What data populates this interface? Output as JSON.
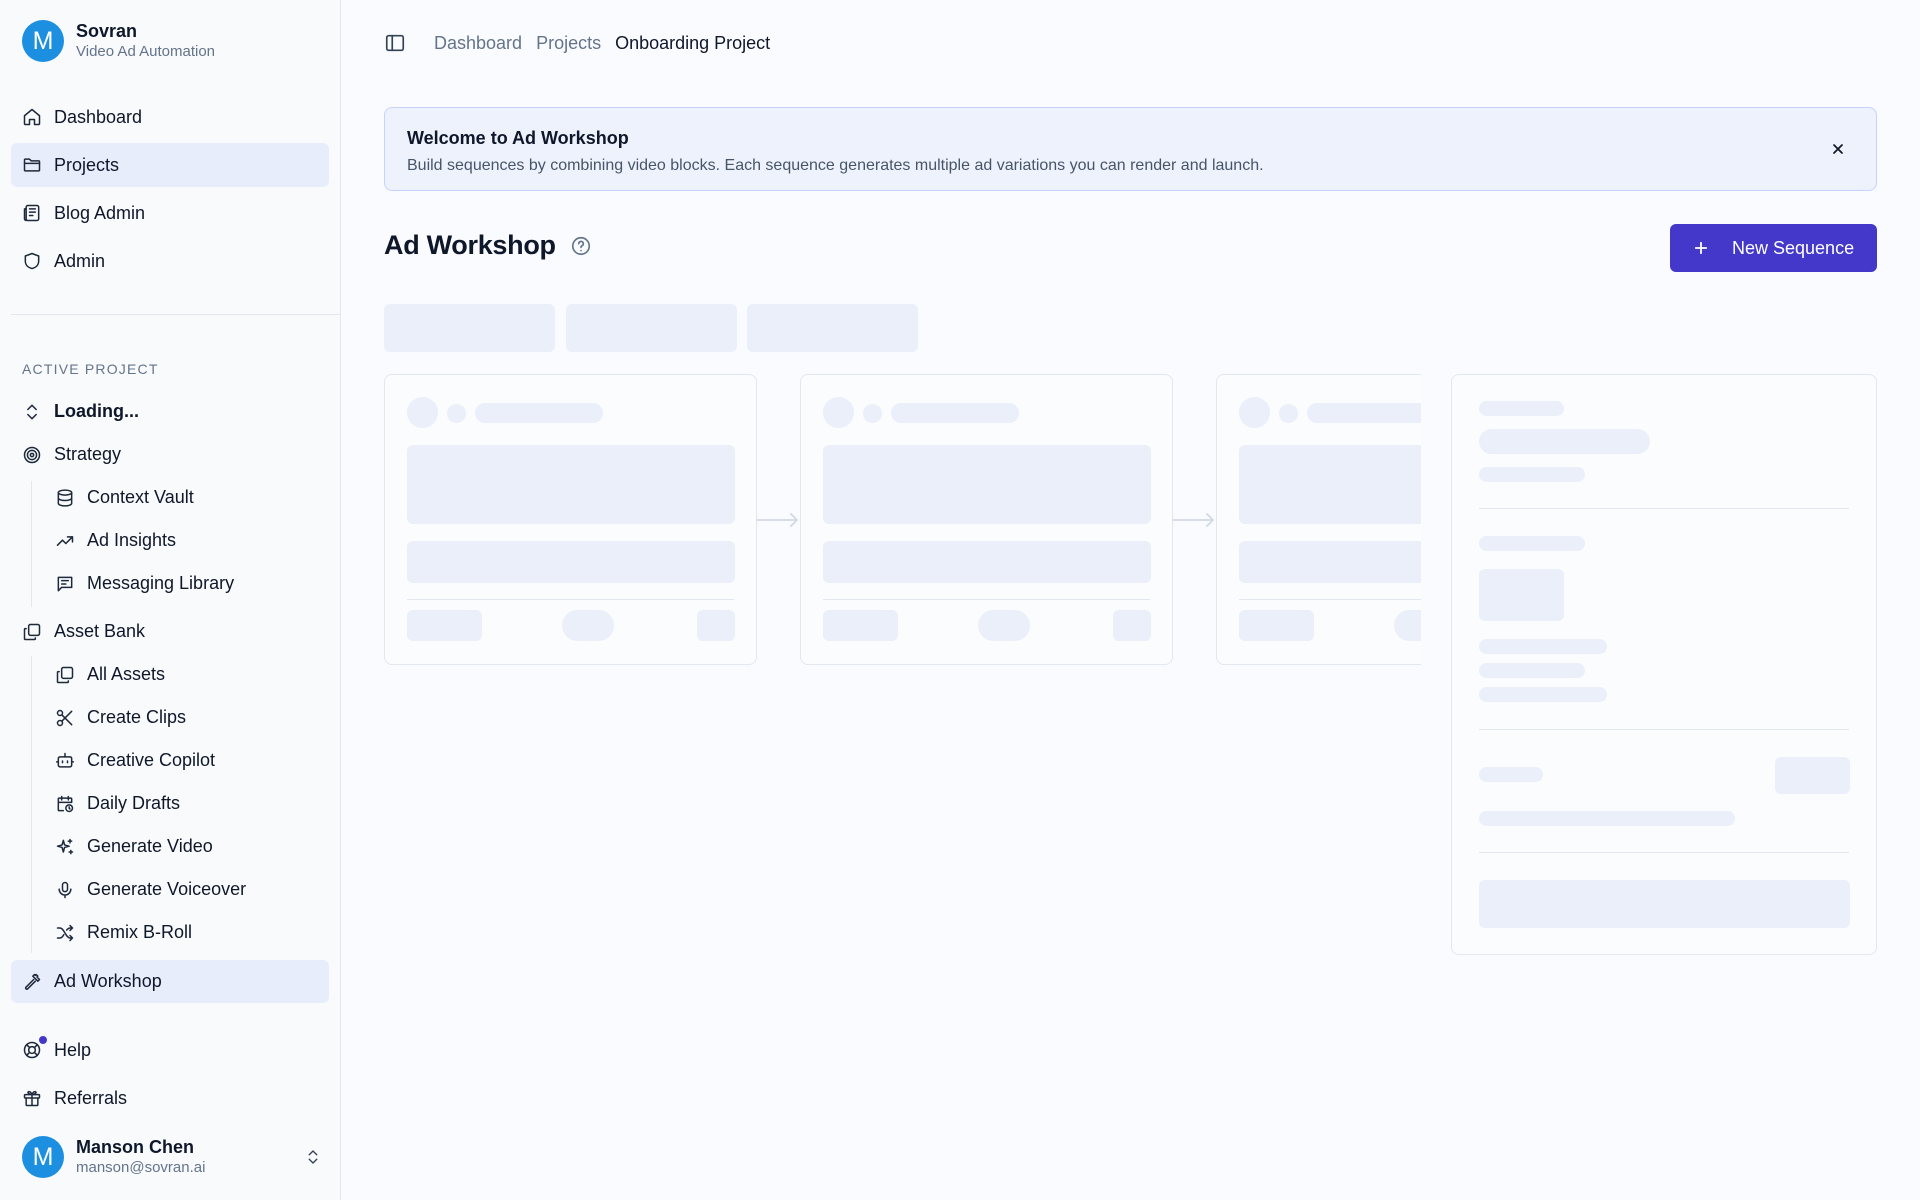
{
  "brand": {
    "initial": "M",
    "name": "Sovran",
    "subtitle": "Video Ad Automation"
  },
  "nav": {
    "main": [
      {
        "label": "Dashboard",
        "icon": "home-icon"
      },
      {
        "label": "Projects",
        "icon": "folder-icon",
        "active": true
      },
      {
        "label": "Blog Admin",
        "icon": "newspaper-icon"
      },
      {
        "label": "Admin",
        "icon": "shield-icon"
      }
    ],
    "section_label": "ACTIVE PROJECT",
    "project_selector": "Loading...",
    "strategy": {
      "label": "Strategy",
      "items": [
        "Context Vault",
        "Ad Insights",
        "Messaging Library"
      ]
    },
    "asset_bank": {
      "label": "Asset Bank",
      "items": [
        "All Assets",
        "Create Clips",
        "Creative Copilot",
        "Daily Drafts",
        "Generate Video",
        "Generate Voiceover",
        "Remix B-Roll"
      ]
    },
    "ad_workshop": "Ad Workshop",
    "bottom": [
      {
        "label": "Help",
        "icon": "lifebuoy-icon",
        "has_notification": true
      },
      {
        "label": "Referrals",
        "icon": "gift-icon"
      }
    ]
  },
  "user": {
    "initial": "M",
    "name": "Manson Chen",
    "email": "manson@sovran.ai"
  },
  "breadcrumb": [
    "Dashboard",
    "Projects",
    "Onboarding Project"
  ],
  "banner": {
    "title": "Welcome to Ad Workshop",
    "description": "Build sequences by combining video blocks. Each sequence generates multiple ad variations you can render and launch."
  },
  "page": {
    "title": "Ad Workshop",
    "new_button": "New Sequence"
  },
  "colors": {
    "accent": "#4338ca",
    "avatar": "#1d8fe1",
    "skeleton": "#eaeff9",
    "active_nav": "#e8edfb"
  }
}
